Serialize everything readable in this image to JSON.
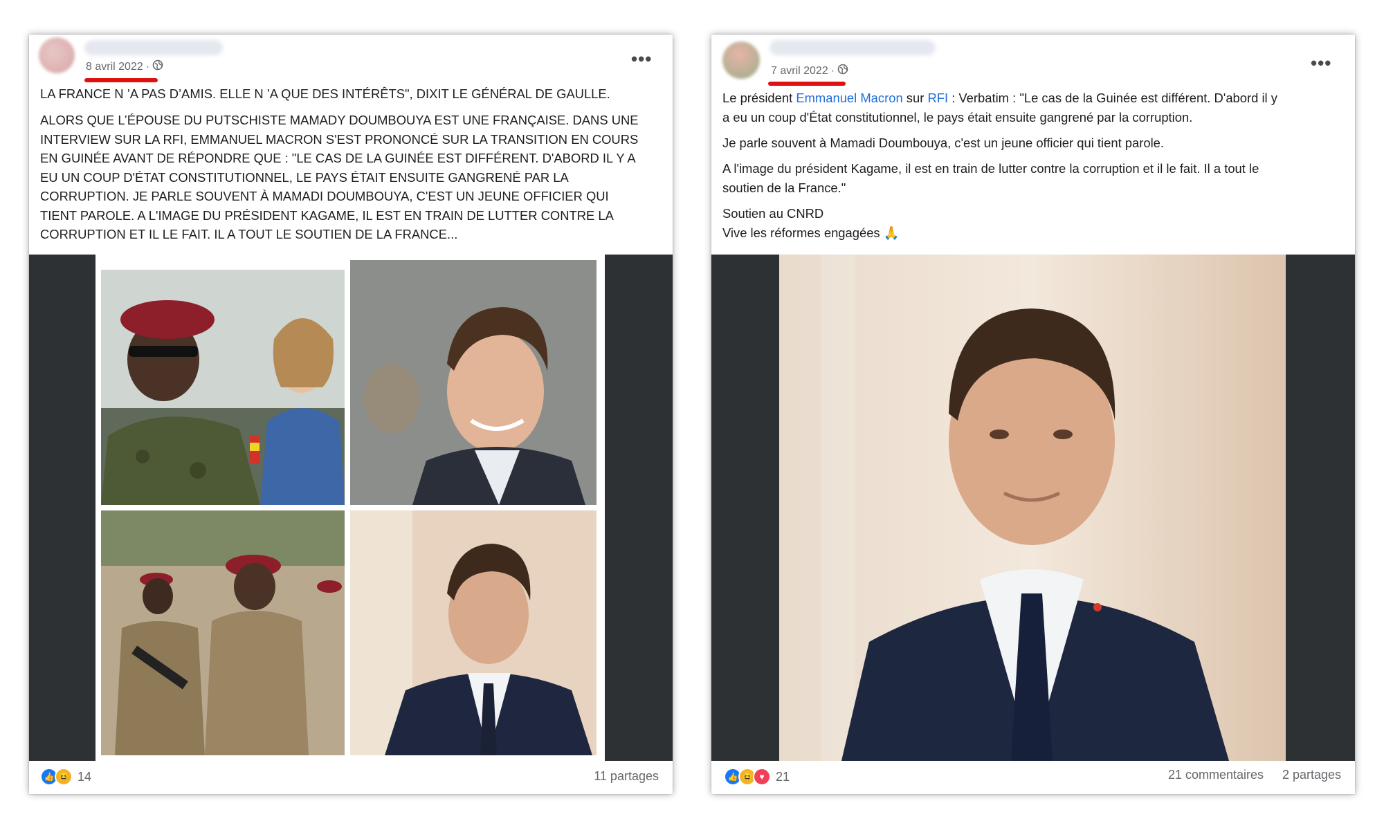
{
  "left_post": {
    "date": "8 avril 2022",
    "privacy_icon": "globe-icon",
    "more_icon": "more-options-icon",
    "more_label": "•••",
    "separator": "·",
    "paragraph_1": "La France n ’a pas d’amis. Elle n ’a que des intérêts\", dixit le Général de Gaulle.",
    "paragraph_2_lines": [
      "Alors que l’épouse du putschiste Mamady Doumbouya est une française. Dans une",
      "interview sur la RFI, Emmanuel Macron s'est prononcé sur la transition en cours",
      "en Guinée avant de répondre que  : \"Le cas de la Guinée est différent. D'abord il y a",
      "eu un coup d'État constitutionnel, le pays était ensuite gangrené par la",
      "corruption. Je parle souvent à Mamadi Doumbouya, c'est un jeune officier qui",
      "tient parole. A l'image du président Kagame, il est en train de lutter contre la",
      "corruption et il le fait. Il a tout le soutien de la France..."
    ],
    "reaction_count": "14",
    "shares": "11 partages"
  },
  "right_post": {
    "date": "7 avril 2022",
    "privacy_icon": "globe-icon",
    "more_icon": "more-options-icon",
    "more_label": "•••",
    "separator": "·",
    "p1_prefix": "Le président ",
    "p1_link_1": "Emmanuel Macron",
    "p1_middle": " sur ",
    "p1_link_2": "RFI",
    "p1_rest_line1": "  : Verbatim : \"Le cas de la Guinée est différent. D'abord il y",
    "p1_line2": "a eu un coup d'État constitutionnel, le pays était ensuite gangrené par la corruption.",
    "p2": "Je parle souvent à Mamadi Doumbouya, c'est un jeune officier qui tient parole.",
    "p3_line1": "A l'image du président Kagame, il est en train de lutter contre la corruption et il le fait. Il a tout le",
    "p3_line2": "soutien de la France.\"",
    "p4_line1": "Soutien au CNRD",
    "p4_line2": "Vive les réformes engagées",
    "p4_emoji": "🙏",
    "reaction_count": "21",
    "comments": "21 commentaires",
    "shares": "2 partages"
  },
  "colors": {
    "underline": "#e01010",
    "link": "#216fdb",
    "like": "#1877f2",
    "love": "#f33e58",
    "haha": "#f7b125"
  }
}
